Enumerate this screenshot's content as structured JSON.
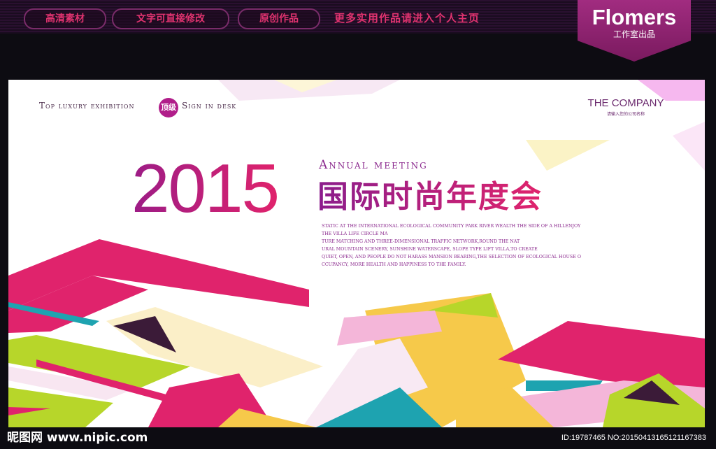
{
  "topbar": {
    "pill_1": "高清素材",
    "pill_2": "文字可直接修改",
    "pill_3": "原创作品",
    "promo": "更多实用作品请进入个人主页",
    "brand_name": "Flomers",
    "brand_sub": "工作室出品"
  },
  "banner": {
    "top_luxury": "Top luxury exhibition",
    "badge": "顶级",
    "sign": "Sign in desk",
    "company": "THE COMPANY",
    "company_sub": "请输入您的公司名称",
    "year": "2015",
    "annual": "Annual meeting",
    "cn_title": "国际时尚年度会",
    "body_lines": [
      "STATIC AT THE INTERNATIONAL ECOLOGICAL COMMUNITY PARK RIVER WEALTH THE SIDE OF A HILLENJOY",
      "THE VILLA LIFE CIRCLE MA",
      "TURE MATCHING AND THREE-DIMENSIONAL TRAFFIC NETWORK,ROUND THE NAT",
      "URAL MOUNTAIN SCENERY, SUNSHINE WATERSCAPE, SLOPE TYPE LIFT VILLA,TO CREATE",
      "QUIET, OPEN, AND PEOPLE DO NOT HARASS MANSION BEARING,THE SELECTION OF ECOLOGICAL HOUSE O",
      "CCUPANCY, MORE HEALTH AND HAPPINESS TO THE FAMILY."
    ]
  },
  "footer": {
    "logo": "昵图网 www.nipic.com",
    "id_text": "ID:19787465 NO:20150413165121167383"
  },
  "colors": {
    "magenta": "#e0236c",
    "purple": "#8b2a8e",
    "lime": "#b7d62a",
    "yellow": "#f6c94a",
    "teal": "#1ea3b0",
    "dark": "#3b1b38"
  }
}
